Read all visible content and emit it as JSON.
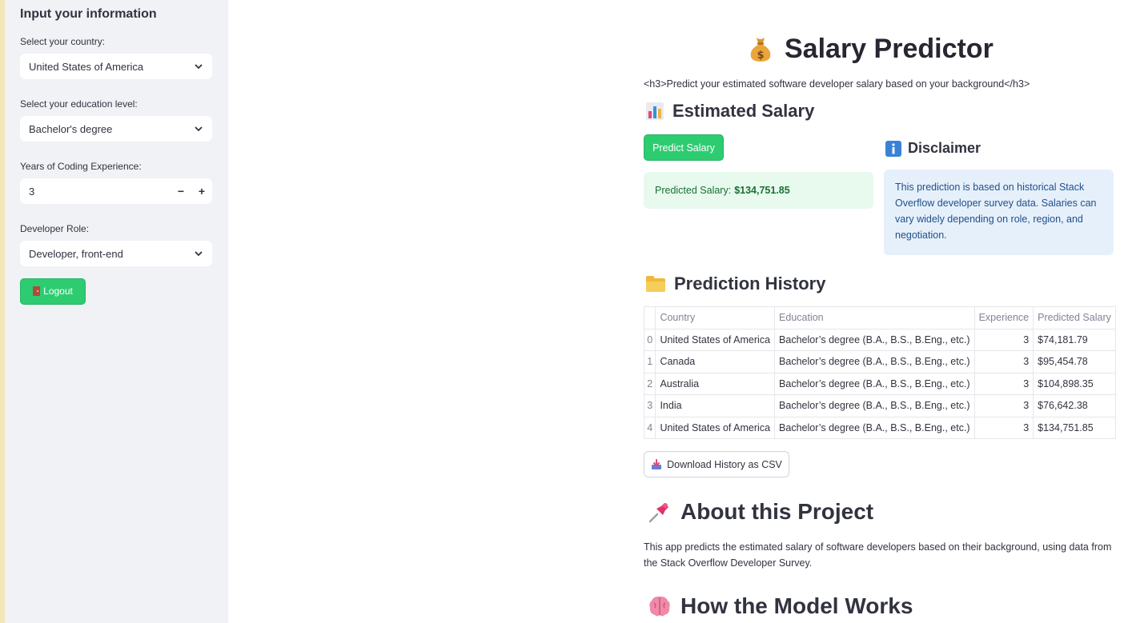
{
  "sidebar": {
    "heading": "Input your information",
    "country": {
      "label": "Select your country:",
      "value": "United States of America"
    },
    "education": {
      "label": "Select your education level:",
      "value": "Bachelor's degree"
    },
    "experience": {
      "label": "Years of Coding Experience:",
      "value": "3",
      "minus": "−",
      "plus": "+"
    },
    "role": {
      "label": "Developer Role:",
      "value": "Developer, front-end"
    },
    "logout_label": "Logout"
  },
  "main": {
    "title": "Salary Predictor",
    "subtitle": "<h3>Predict your estimated software developer salary based on your background</h3>",
    "estimated_heading": "Estimated Salary",
    "predict_button": "Predict Salary",
    "predicted_label": "Predicted Salary:",
    "predicted_value": "$134,751.85",
    "disclaimer_heading": "Disclaimer",
    "disclaimer_text": "This prediction is based on historical Stack Overflow developer survey data. Salaries can vary widely depending on role, region, and negotiation.",
    "history_heading": "Prediction History",
    "table": {
      "headers": [
        "",
        "Country",
        "Education",
        "Experience",
        "Predicted Salary"
      ],
      "rows": [
        [
          "0",
          "United States of America",
          "Bachelor’s degree (B.A., B.S., B.Eng., etc.)",
          "3",
          "$74,181.79"
        ],
        [
          "1",
          "Canada",
          "Bachelor’s degree (B.A., B.S., B.Eng., etc.)",
          "3",
          "$95,454.78"
        ],
        [
          "2",
          "Australia",
          "Bachelor’s degree (B.A., B.S., B.Eng., etc.)",
          "3",
          "$104,898.35"
        ],
        [
          "3",
          "India",
          "Bachelor’s degree (B.A., B.S., B.Eng., etc.)",
          "3",
          "$76,642.38"
        ],
        [
          "4",
          "United States of America",
          "Bachelor’s degree (B.A., B.S., B.Eng., etc.)",
          "3",
          "$134,751.85"
        ]
      ]
    },
    "download_button": "Download History as CSV",
    "about_heading": "About this Project",
    "about_text": "This app predicts the estimated salary of software developers based on their background, using data from the Stack Overflow Developer Survey.",
    "model_heading": "How the Model Works"
  },
  "colors": {
    "sidebar_bg": "#f0f2f6",
    "accent_green": "#2ecc71",
    "success_bg": "#e8f9ee",
    "info_bg": "#e6f0fb"
  },
  "icons": [
    "money-bag-icon",
    "bar-chart-icon",
    "info-icon",
    "folder-icon",
    "download-tray-icon",
    "pushpin-icon",
    "brain-icon",
    "door-icon",
    "chevron-down-icon"
  ]
}
